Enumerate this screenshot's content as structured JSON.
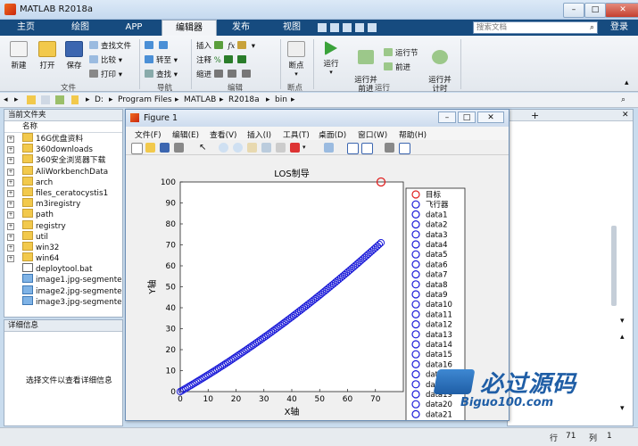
{
  "app": {
    "title": "MATLAB R2018a",
    "search_placeholder": "搜索文档",
    "login": "登录"
  },
  "ribbon": {
    "tabs": [
      {
        "label": "主页"
      },
      {
        "label": "绘图"
      },
      {
        "label": "APP"
      },
      {
        "label": "编辑器"
      },
      {
        "label": "发布"
      },
      {
        "label": "视图"
      }
    ],
    "file_group": {
      "new": "新建",
      "open": "打开",
      "save": "保存",
      "find_files": "查找文件",
      "compare": "比较",
      "print": "打印",
      "label": "文件"
    },
    "nav_group": {
      "goto": "转至",
      "find": "查找",
      "label": "导航"
    },
    "edit_group": {
      "insert": "插入",
      "comment": "注释",
      "indent": "缩进",
      "label": "编辑"
    },
    "breakpoint_group": {
      "breakpoints": "断点",
      "label": "断点"
    },
    "run_group": {
      "run": "运行",
      "run_advance": "运行并\n前进",
      "run_section": "运行节",
      "advance": "前进",
      "run_time": "运行并\n计时",
      "label": "运行"
    }
  },
  "path": [
    "D:",
    "Program Files",
    "MATLAB",
    "R2018a",
    "bin"
  ],
  "folder_panel": {
    "title": "当前文件夹",
    "column": "名称",
    "items": [
      {
        "name": "16G优盘资料",
        "type": "folder"
      },
      {
        "name": "360downloads",
        "type": "folder"
      },
      {
        "name": "360安全浏览器下载",
        "type": "folder"
      },
      {
        "name": "AliWorkbenchData",
        "type": "folder"
      },
      {
        "name": "arch",
        "type": "folder"
      },
      {
        "name": "files_ceratocystis1",
        "type": "folder"
      },
      {
        "name": "m3iregistry",
        "type": "folder"
      },
      {
        "name": "path",
        "type": "folder"
      },
      {
        "name": "registry",
        "type": "folder"
      },
      {
        "name": "util",
        "type": "folder"
      },
      {
        "name": "win32",
        "type": "folder"
      },
      {
        "name": "win64",
        "type": "folder"
      },
      {
        "name": "deploytool.bat",
        "type": "file"
      },
      {
        "name": "image1.jpg-segmente...",
        "type": "img"
      },
      {
        "name": "image2.jpg-segmente...",
        "type": "img"
      },
      {
        "name": "image3.jpg-segmente...",
        "type": "img"
      }
    ]
  },
  "detail_panel": {
    "title": "详细信息",
    "message": "选择文件以查看详细信息"
  },
  "status": {
    "row_label": "行",
    "row": "71",
    "col_label": "列",
    "col": "1"
  },
  "figure": {
    "title": "Figure 1",
    "menus": [
      "文件(F)",
      "编辑(E)",
      "查看(V)",
      "插入(I)",
      "工具(T)",
      "桌面(D)",
      "窗口(W)",
      "帮助(H)"
    ]
  },
  "chart_data": {
    "type": "scatter",
    "title": "LOS制导",
    "xlabel": "X轴",
    "ylabel": "Y轴",
    "xlim": [
      0,
      80
    ],
    "ylim": [
      0,
      100
    ],
    "xticks": [
      0,
      10,
      20,
      30,
      40,
      50,
      60,
      70
    ],
    "yticks": [
      0,
      10,
      20,
      30,
      40,
      50,
      60,
      70,
      80,
      90,
      100
    ],
    "series": [
      {
        "name": "目标",
        "color": "#e02020",
        "points": [
          [
            72,
            100
          ]
        ]
      },
      {
        "name": "飞行器",
        "color": "#1a1ad8",
        "start": [
          0,
          0
        ],
        "end": [
          72,
          71
        ]
      }
    ],
    "legend_entries": [
      "目标",
      "飞行器",
      "data1",
      "data2",
      "data3",
      "data4",
      "data5",
      "data6",
      "data7",
      "data8",
      "data9",
      "data10",
      "data11",
      "data12",
      "data13",
      "data14",
      "data15",
      "data16",
      "data17",
      "data18",
      "data19",
      "data20",
      "data21"
    ],
    "legend_position": "right, overflowing below axes"
  },
  "watermark": {
    "text": "必过源码",
    "url_text": "Biguo100.com"
  },
  "colors": {
    "ribbon_dark": "#164b7f",
    "target": "#e02020",
    "aircraft": "#1a1ad8"
  }
}
